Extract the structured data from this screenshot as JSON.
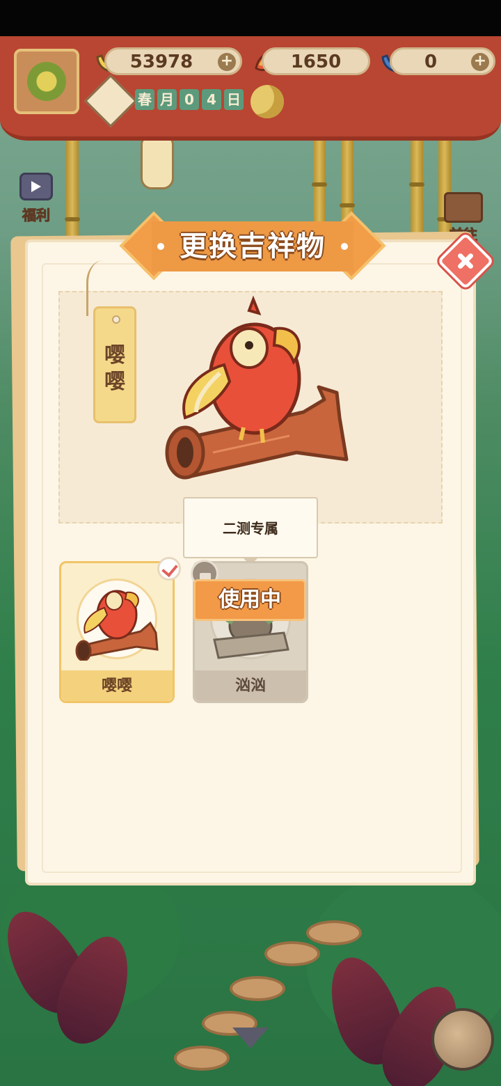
{
  "resources": [
    {
      "name": "banana",
      "amount": "53978",
      "color": "#e9c043"
    },
    {
      "name": "fire-pepper",
      "amount": "1650",
      "color": "#e25c37"
    },
    {
      "name": "blue-banana",
      "amount": "0",
      "color": "#4d7ec3"
    }
  ],
  "plus_symbol": "+",
  "date_chips": [
    "春",
    "月",
    "0",
    "4",
    "日"
  ],
  "side_buttons": {
    "welfare": "福利",
    "goto": "前往"
  },
  "modal": {
    "title": "更换吉祥物",
    "selected_name_chars": [
      "嘤",
      "嘤"
    ],
    "tooltip": "二测专属",
    "in_use_label": "使用中",
    "cards": [
      {
        "name": "嘤嘤",
        "selected": true,
        "locked": false
      },
      {
        "name": "汹汹",
        "selected": false,
        "locked": true
      }
    ]
  },
  "colors": {
    "accent_orange": "#f29a48",
    "curtain_red": "#b84632",
    "close_red": "#ef7064"
  }
}
